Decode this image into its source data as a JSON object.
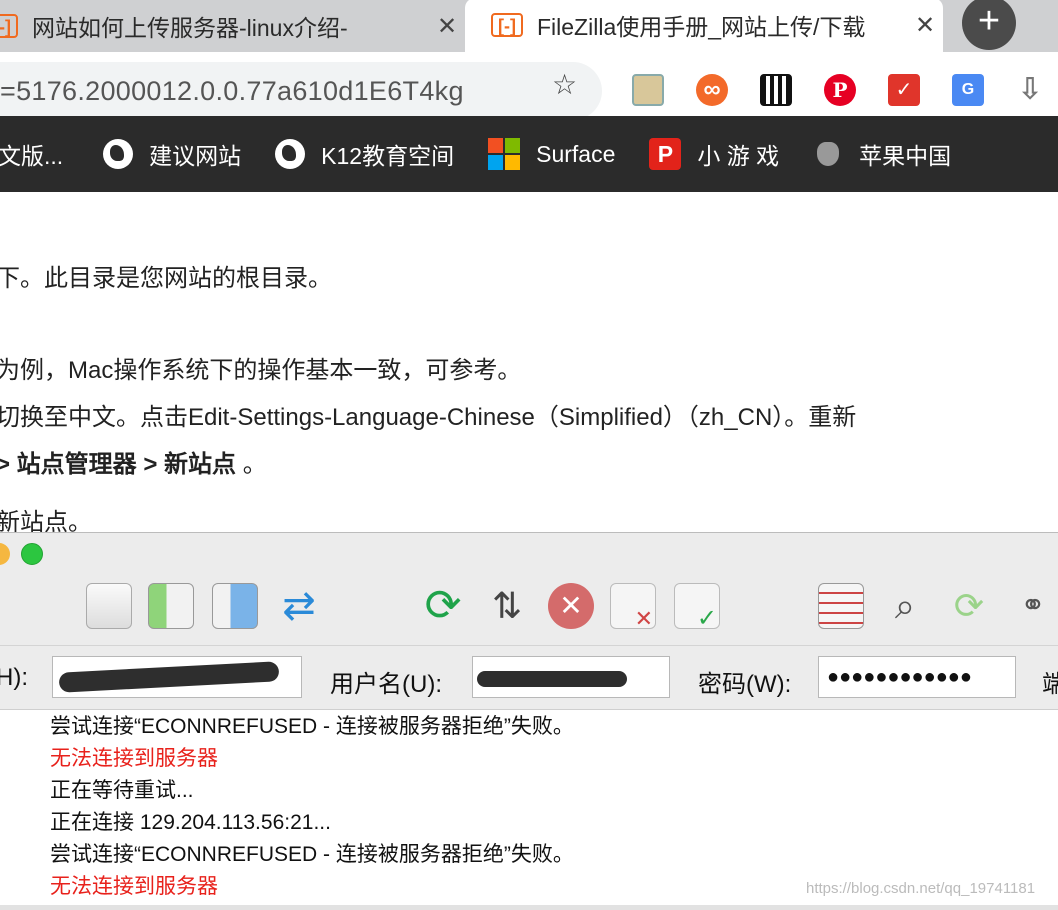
{
  "browser": {
    "tabs": [
      {
        "title": "网站如何上传服务器-linux介绍-",
        "close": "✕"
      },
      {
        "title": "FileZilla使用手册_网站上传/下载",
        "close": "✕"
      }
    ],
    "new_tab": "+",
    "url": "=5176.2000012.0.0.77a610d1E6T4kg",
    "bookmarks": [
      {
        "label": "文版...",
        "icon": "none"
      },
      {
        "label": "建议网站",
        "icon": "globe-icon"
      },
      {
        "label": "K12教育空间",
        "icon": "globe-icon"
      },
      {
        "label": "Surface",
        "icon": "microsoft-icon"
      },
      {
        "label": "小 游 戏",
        "icon": "p-icon"
      },
      {
        "label": "苹果中国",
        "icon": "apple-icon"
      }
    ]
  },
  "article": {
    "line1": "下。此目录是您网站的根目录。",
    "line2": "为例，Mac操作系统下的操作基本一致，可参考。",
    "line3": "切换至中文。点击Edit-Settings-Language-Chinese（Simplified）（zh_CN）。重新",
    "line4_bold": "> 站点管理器 > 新站点",
    "line4_end": " 。",
    "line5": "新站点。"
  },
  "filezilla": {
    "host_label": "H):",
    "user_label": "用户名(U):",
    "password_label": "密码(W):",
    "password_value": "●●●●●●●●●●●●",
    "port_label_partial": "端",
    "log": [
      {
        "text": "尝试连接“ECONNREFUSED - 连接被服务器拒绝”失败。",
        "error": false
      },
      {
        "text": "无法连接到服务器",
        "error": true
      },
      {
        "text": "正在等待重试...",
        "error": false
      },
      {
        "text": "正在连接 129.204.113.56:21...",
        "error": false
      },
      {
        "text": "尝试连接“ECONNREFUSED - 连接被服务器拒绝”失败。",
        "error": false
      },
      {
        "text": "无法连接到服务器",
        "error": true
      }
    ]
  },
  "watermark": "https://blog.csdn.net/qq_19741181",
  "colors": {
    "accent": "#f06a1f",
    "error": "#e8211b",
    "bookmark_bar": "#2b2b2b"
  }
}
